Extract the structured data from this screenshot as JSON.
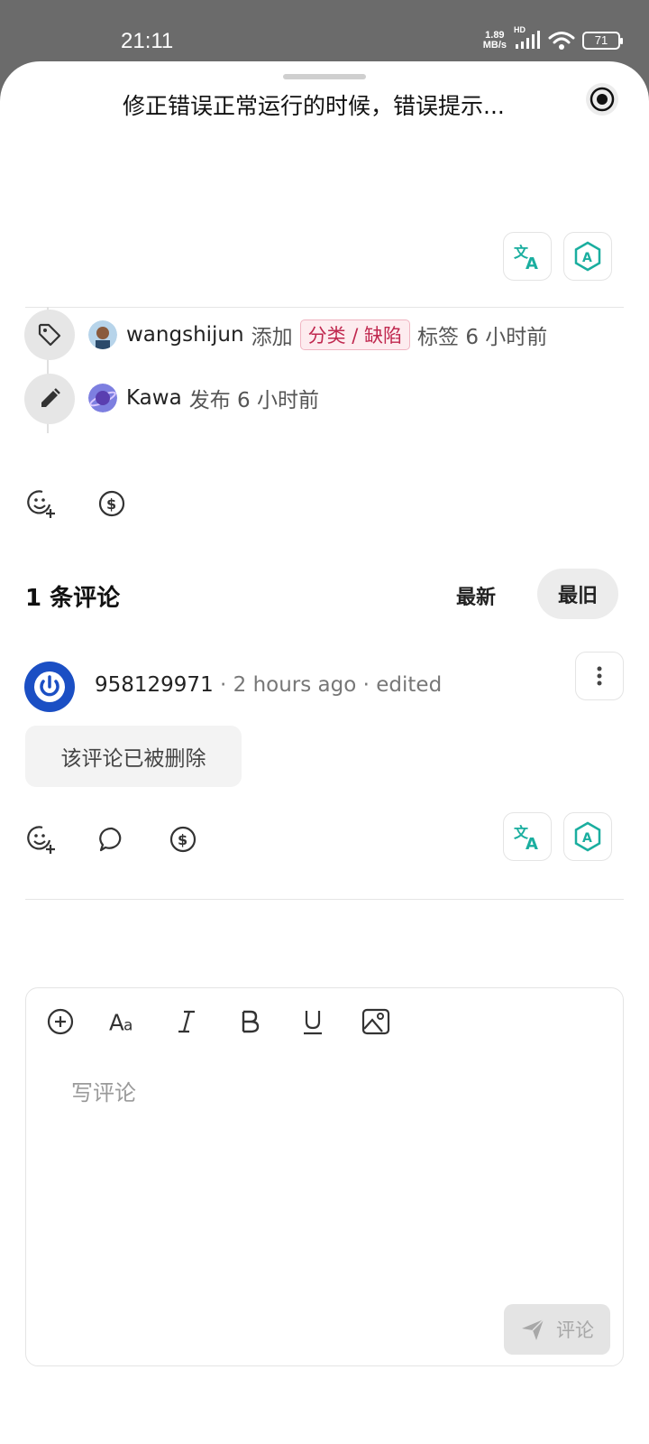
{
  "status_bar": {
    "time": "21:11",
    "net_speed_value": "1.89",
    "net_speed_unit": "MB/s",
    "network_badge": "HD",
    "battery": "71"
  },
  "sheet": {
    "title": "修正错误正常运行的时候，错误提示..."
  },
  "timeline": [
    {
      "icon": "tag-icon",
      "user": "wangshijun",
      "action": "添加",
      "tag": "分类 / 缺陷",
      "suffix": "标签 6 小时前"
    },
    {
      "icon": "pencil-icon",
      "user": "Kawa",
      "suffix": "发布 6 小时前"
    }
  ],
  "comments": {
    "count_label": "1 条评论",
    "sort_newest": "最新",
    "sort_oldest": "最旧",
    "items": [
      {
        "author": "958129971",
        "meta": " · 2 hours ago · edited",
        "content": "该评论已被删除"
      }
    ]
  },
  "editor": {
    "placeholder": "写评论",
    "submit_label": "评论"
  },
  "colors": {
    "accent_teal": "#1aae9f",
    "tag_text": "#c0284f",
    "avatar_blue": "#1b4fc4"
  }
}
